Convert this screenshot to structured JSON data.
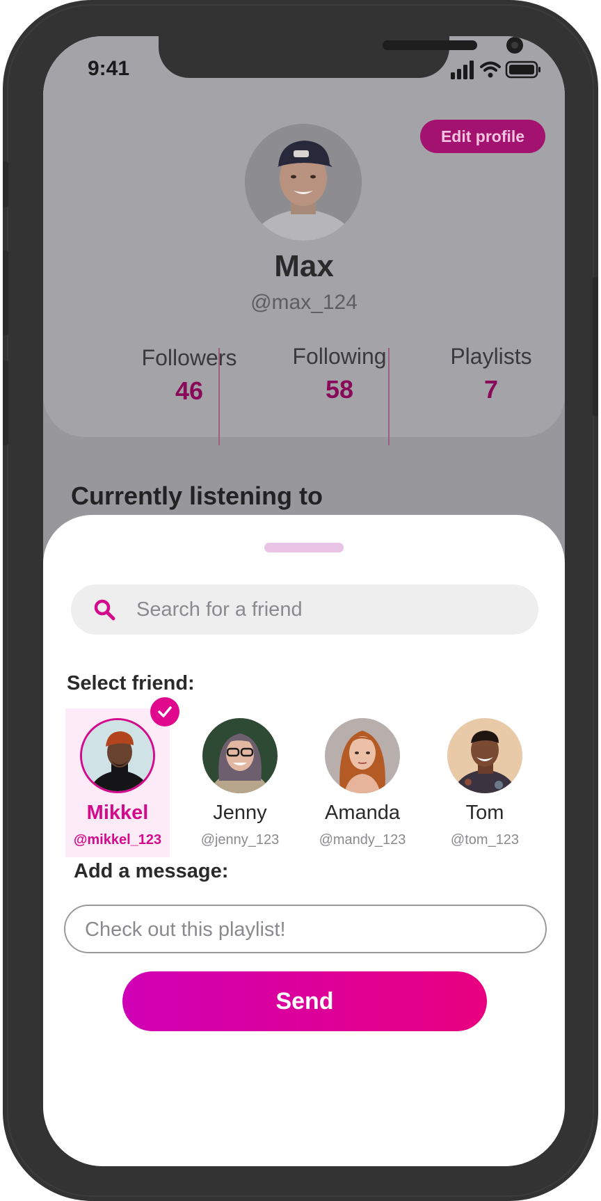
{
  "status_bar": {
    "time": "9:41"
  },
  "profile": {
    "edit_label": "Edit profile",
    "name": "Max",
    "handle": "@max_124",
    "stats": [
      {
        "label": "Followers",
        "value": "46"
      },
      {
        "label": "Following",
        "value": "58"
      },
      {
        "label": "Playlists",
        "value": "7"
      }
    ],
    "section_title": "Currently listening to"
  },
  "share_sheet": {
    "search_placeholder": "Search for a friend",
    "select_label": "Select friend:",
    "friends": [
      {
        "name": "Mikkel",
        "handle": "@mikkel_123",
        "selected": true
      },
      {
        "name": "Jenny",
        "handle": "@jenny_123",
        "selected": false
      },
      {
        "name": "Amanda",
        "handle": "@mandy_123",
        "selected": false
      },
      {
        "name": "Tom",
        "handle": "@tom_123",
        "selected": false
      }
    ],
    "message_label": "Add a message:",
    "message_placeholder": "Check out this playlist!",
    "send_label": "Send"
  },
  "colors": {
    "accent": "#d40a8c",
    "accent_dark": "#8a0a5a",
    "send_gradient_start": "#d000b6",
    "send_gradient_end": "#e8007f"
  }
}
